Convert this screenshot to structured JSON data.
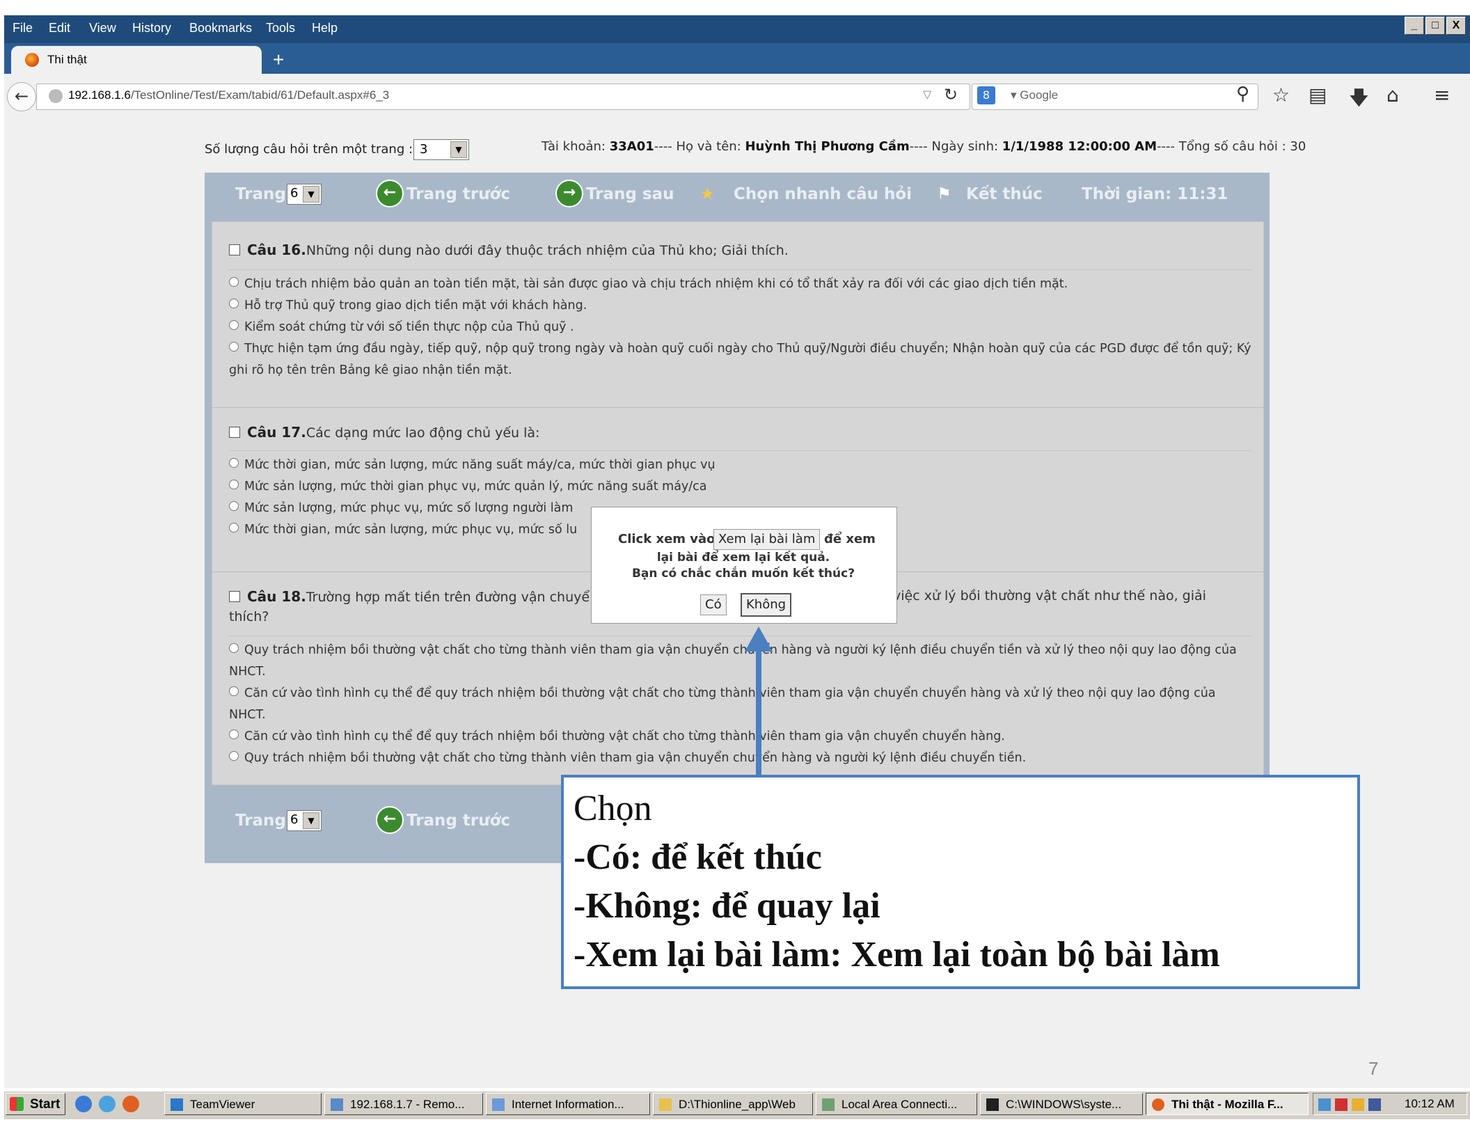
{
  "menu": [
    "File",
    "Edit",
    "View",
    "History",
    "Bookmarks",
    "Tools",
    "Help"
  ],
  "window_controls": [
    "_",
    "□",
    "X"
  ],
  "tab": {
    "title": "Thi thật",
    "new_tab": "+"
  },
  "url": {
    "host": "192.168.1.6",
    "path": "/TestOnline/Test/Exam/tabid/61/Default.aspx#6_3"
  },
  "search": {
    "engine": "8",
    "placeholder": "Google"
  },
  "toolbar_icons": [
    "star-icon",
    "reading-list-icon",
    "download-icon",
    "home-icon",
    "menu-icon"
  ],
  "page": {
    "per_page_label": "Số lượng câu hỏi trên một trang :",
    "per_page_value": "3",
    "account": {
      "account_label": "Tài khoản:",
      "account_value": "33A01",
      "name_label": "---- Họ và tên:",
      "name_value": "Huỳnh Thị Phương Cầm",
      "dob_label": "---- Ngày sinh:",
      "dob_value": "1/1/1988 12:00:00 AM",
      "total_label": "---- Tổng số câu hỏi : 30"
    }
  },
  "nav": {
    "page_label": "Trang",
    "page_value": "6",
    "prev": "Trang trước",
    "next": "Trang sau",
    "quick": "Chọn nhanh câu hỏi",
    "finish": "Kết thúc",
    "time": "Thời gian: 11:31"
  },
  "questions": [
    {
      "number": "Câu 16.",
      "text": "Những nội dung nào dưới đây thuộc trách nhiệm của Thủ kho; Giải thích.",
      "options": [
        "Chịu trách nhiệm bảo quản an toàn tiền mặt, tài sản được giao và chịu trách nhiệm khi có tổ thất xảy ra đối với các giao dịch tiền mặt.",
        "Hỗ trợ Thủ quỹ trong giao dịch tiền mặt với khách hàng.",
        "Kiểm soát chứng từ với số tiền thực nộp của Thủ quỹ .",
        "Thực hiện tạm ứng đầu ngày, tiếp quỹ, nộp quỹ trong ngày và hoàn quỹ cuối ngày cho Thủ quỹ/Người điều chuyển; Nhận hoàn quỹ của các PGD được để tồn quỹ; Ký ghi rõ họ tên trên Bảng kê giao nhận tiền mặt."
      ]
    },
    {
      "number": "Câu 17.",
      "text": "Các dạng mức lao động chủ yếu là:",
      "options": [
        "Mức thời gian, mức sản lượng, mức năng suất máy/ca, mức thời gian phục vụ",
        "Mức sản lượng, mức thời gian phục vụ, mức quản lý, mức năng suất máy/ca",
        "Mức sản lượng, mức phục vụ, mức số lượng người làm",
        "Mức thời gian, mức sản lượng, mức phục vụ, mức số lu"
      ]
    },
    {
      "number": "Câu 18.",
      "text_left": "Trường hợp mất tiền trên đường vận chuyể",
      "text_right": "việc xử lý bồi thường vật chất như thế nào, giải",
      "text_wrap": "thích?",
      "options": [
        "Quy trách nhiệm bồi thường vật chất cho từng thành viên tham gia vận chuyển chuyển hàng và người ký lệnh điều chuyển tiền và xử lý theo nội quy lao động của NHCT.",
        "Căn cứ vào tình hình cụ thể để quy trách nhiệm bồi thường vật chất cho từng thành viên tham gia vận chuyển chuyển hàng và xử lý theo nội quy lao động của NHCT.",
        "Căn cứ vào tình hình cụ thể để quy trách nhiệm bồi thường vật chất cho từng thành viên tham gia vận chuyển chuyển hàng.",
        "Quy trách nhiệm bồi thường vật chất cho từng thành viên tham gia vận chuyển chuyển hàng và người ký lệnh điều chuyển tiền."
      ]
    }
  ],
  "dialog": {
    "line1_pre": "Click xem vào",
    "review_button": "Xem lại bài làm",
    "line1_post": "để xem",
    "line2": "lại bài để xem lại kết quả.",
    "line3": "Bạn có chắc chắn muốn kết thúc?",
    "yes": "Có",
    "no": "Không"
  },
  "callout": {
    "line1": "Chọn",
    "line2": "-Có: để kết thúc",
    "line3": "-Không: để quay lại",
    "line4": "-Xem lại bài làm: Xem lại toàn bộ bài làm"
  },
  "slide_number": "7",
  "taskbar": {
    "start": "Start",
    "items": [
      "TeamViewer",
      "192.168.1.7 - Remo...",
      "Internet Information...",
      "D:\\Thionline_app\\Web",
      "Local Area Connecti...",
      "C:\\WINDOWS\\syste...",
      "Thi thật - Mozilla F..."
    ],
    "clock": "10:12 AM"
  },
  "colors": {
    "menubar": "#1f4b7a",
    "panel": "#a9b8c9",
    "question_bg": "#d6d6d6",
    "callout_border": "#4a7fc0"
  }
}
